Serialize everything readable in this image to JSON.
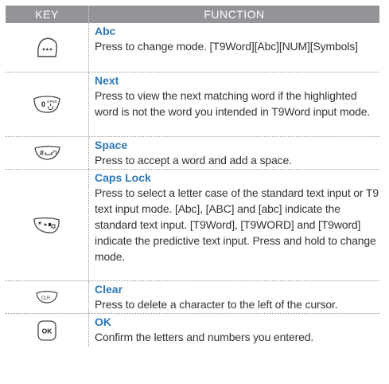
{
  "header": {
    "key": "KEY",
    "function": "FUNCTION"
  },
  "rows": [
    {
      "key_icon": "menu-dots-key-icon",
      "title": "Abc",
      "desc": "Press to change mode. [T9Word][Abc][NUM][Symbols]"
    },
    {
      "key_icon": "zero-oper-key-icon",
      "key_text": "0",
      "key_sub": "OPER",
      "title": "Next",
      "desc": "Press to view the next matching word if the highlighted word is not the word you intended in T9Word input mode."
    },
    {
      "key_icon": "hash-space-key-icon",
      "key_text": "#",
      "title": "Space",
      "desc": "Press to accept a word and add a space."
    },
    {
      "key_icon": "star-shift-key-icon",
      "key_text": "*",
      "title": "Caps Lock",
      "desc": "Press to select a letter case of the standard text input or T9 text input mode. [Abc], [ABC] and [abc] indicate the standard text input. [T9Word], [T9WORD] and [T9word] indicate the predictive text input. Press and hold to change mode."
    },
    {
      "key_icon": "clr-key-icon",
      "key_text": "CLR",
      "title": "Clear",
      "desc": "Press to delete a character to the left of the cursor."
    },
    {
      "key_icon": "ok-key-icon",
      "key_text": "OK",
      "title": "OK",
      "desc": "Confirm the letters and numbers you entered."
    }
  ]
}
